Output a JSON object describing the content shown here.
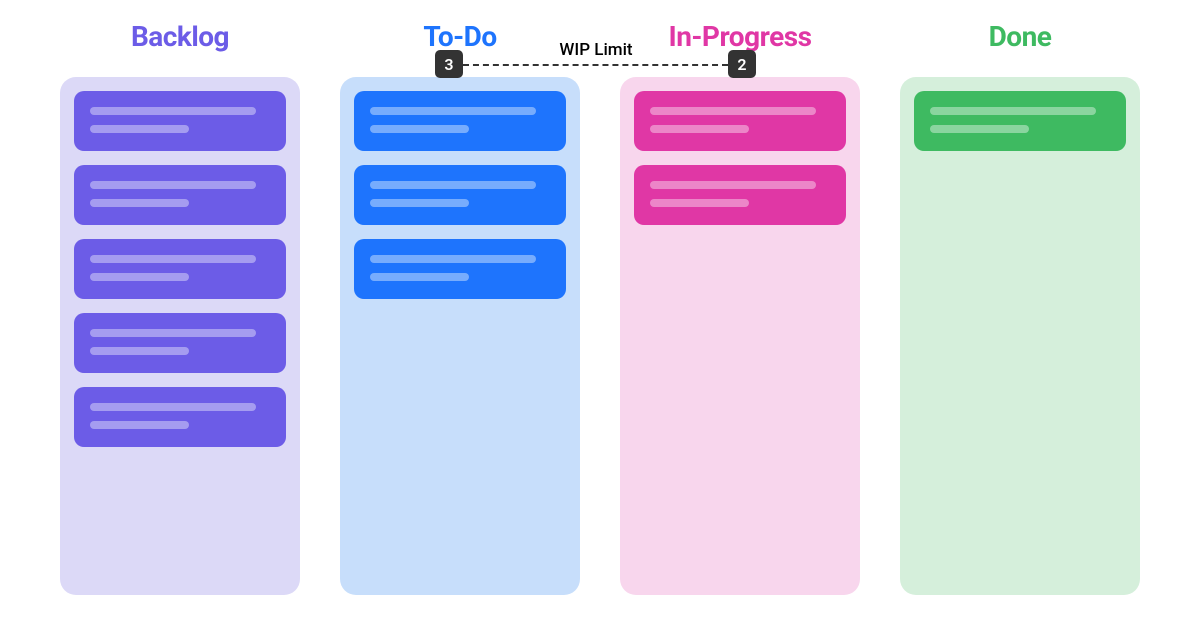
{
  "columns": [
    {
      "id": "backlog",
      "title": "Backlog",
      "theme": "purple",
      "card_count": 5
    },
    {
      "id": "todo",
      "title": "To-Do",
      "theme": "blue",
      "card_count": 3,
      "wip_limit": "3"
    },
    {
      "id": "in_progress",
      "title": "In-Progress",
      "theme": "pink",
      "card_count": 2,
      "wip_limit": "2"
    },
    {
      "id": "done",
      "title": "Done",
      "theme": "green",
      "card_count": 1
    }
  ],
  "wip": {
    "label": "WIP Limit",
    "todo_limit": "3",
    "in_progress_limit": "2"
  },
  "colors": {
    "purple_fg": "#6C5CE7",
    "purple_bg": "#DCD9F7",
    "blue_fg": "#1E74FD",
    "blue_bg": "#C7DEFB",
    "pink_fg": "#E037A5",
    "pink_bg": "#F8D6ED",
    "green_fg": "#3EBA61",
    "green_bg": "#D5EFDB",
    "badge_bg": "#333333"
  }
}
